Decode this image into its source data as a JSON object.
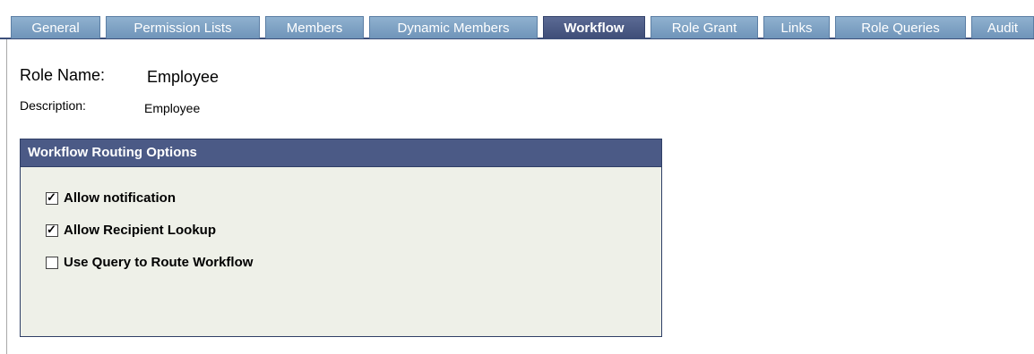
{
  "tabs": [
    {
      "label": "General"
    },
    {
      "label": "Permission Lists"
    },
    {
      "label": "Members"
    },
    {
      "label": "Dynamic Members"
    },
    {
      "label": "Workflow",
      "active": true
    },
    {
      "label": "Role Grant"
    },
    {
      "label": "Links"
    },
    {
      "label": "Role Queries"
    },
    {
      "label": "Audit"
    }
  ],
  "role": {
    "name_label": "Role Name:",
    "name_value": "Employee",
    "desc_label": "Description:",
    "desc_value": "Employee"
  },
  "panel": {
    "title": "Workflow Routing Options",
    "options": [
      {
        "label": "Allow notification",
        "checked": true
      },
      {
        "label": "Allow Recipient Lookup",
        "checked": true
      },
      {
        "label": "Use Query to Route Workflow",
        "checked": false
      }
    ]
  },
  "colors": {
    "tab_inactive": "#7a9ec4",
    "tab_active": "#4b5a86",
    "panel_header": "#4b5a86",
    "panel_body": "#eef0e8"
  }
}
